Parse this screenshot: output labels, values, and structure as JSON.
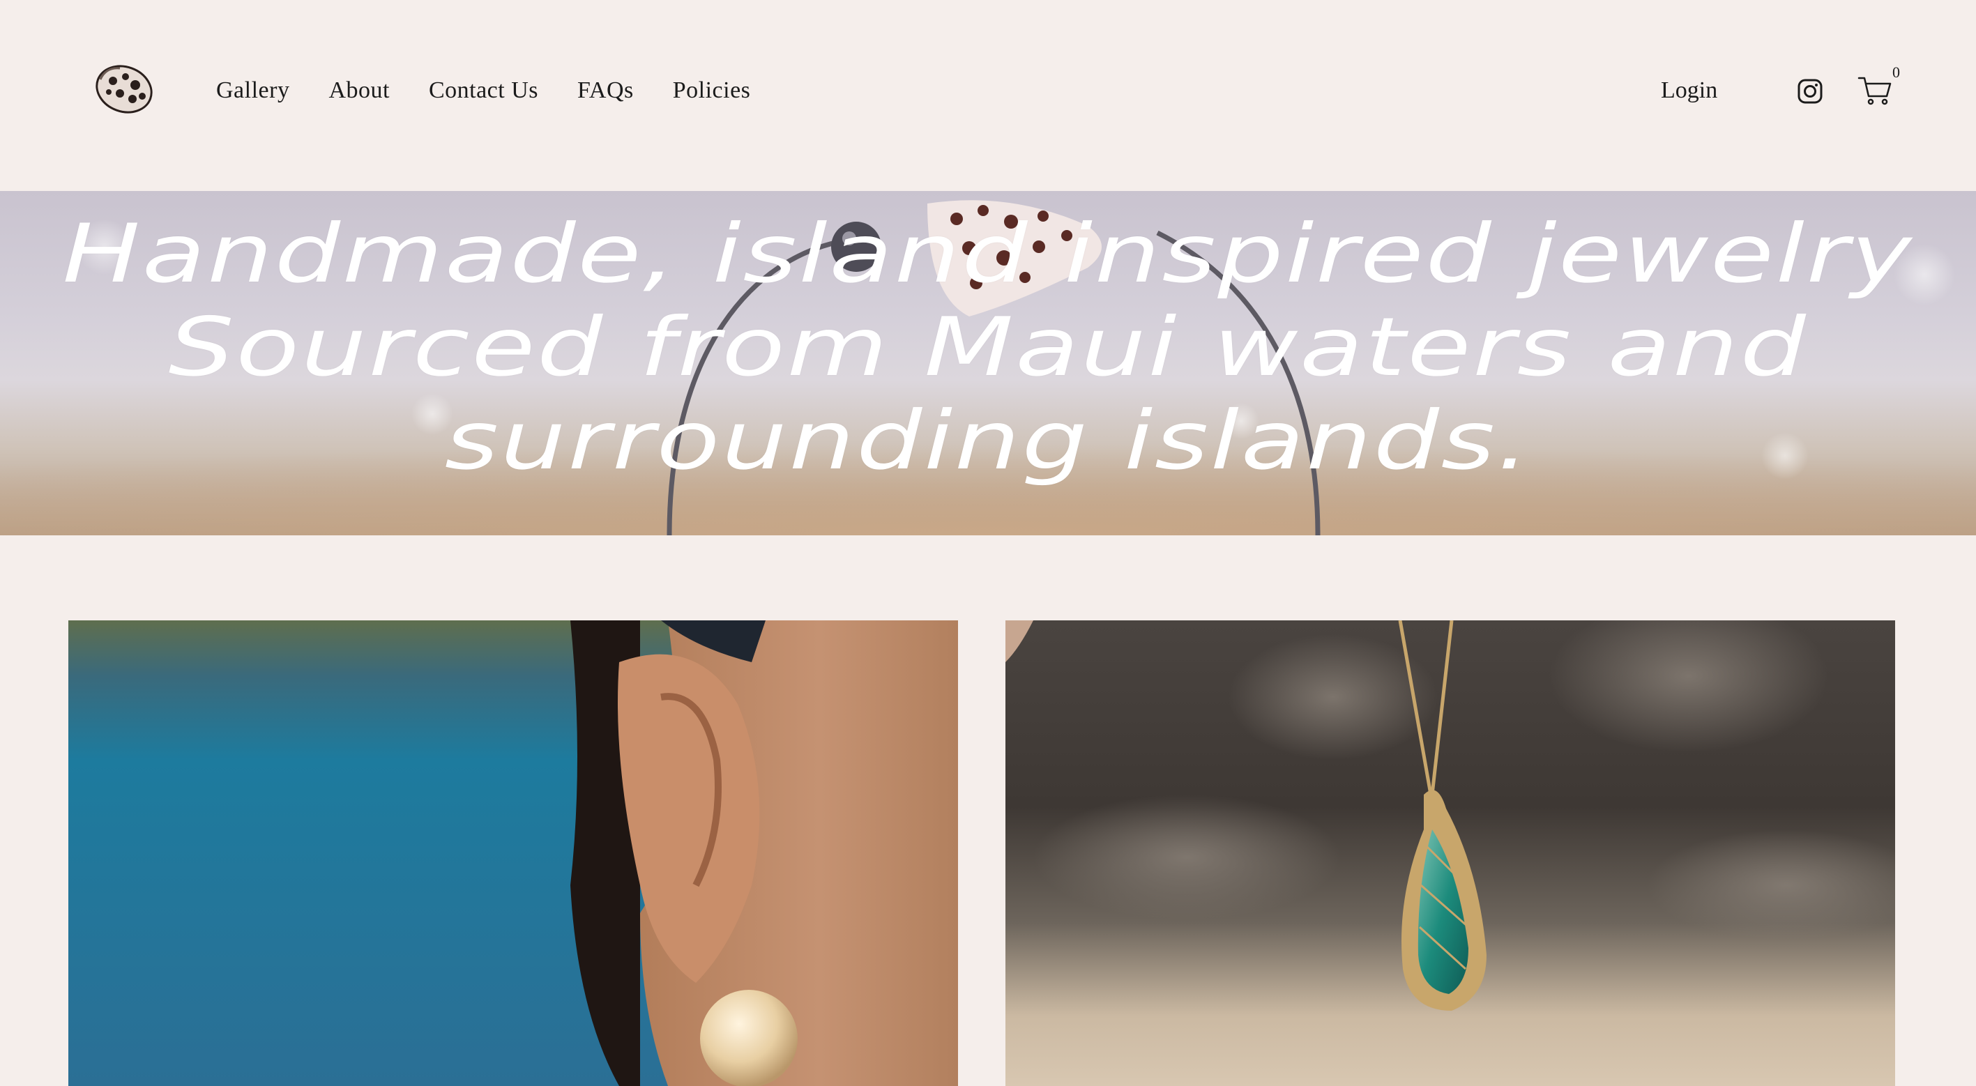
{
  "nav": {
    "items": [
      {
        "label": "Gallery"
      },
      {
        "label": "About"
      },
      {
        "label": "Contact Us"
      },
      {
        "label": "FAQs"
      },
      {
        "label": "Policies"
      }
    ],
    "login_label": "Login",
    "cart_count": "0"
  },
  "icons": {
    "logo": "shell-logo-icon",
    "instagram": "instagram-icon",
    "cart": "cart-icon"
  },
  "hero": {
    "lines": [
      "Handmade, island inspired jewelry",
      "Sourced from Maui waters and",
      "surrounding islands."
    ]
  },
  "colors": {
    "background": "#f5eeeb",
    "text": "#1b1b1b",
    "hero_text": "#ffffff"
  }
}
